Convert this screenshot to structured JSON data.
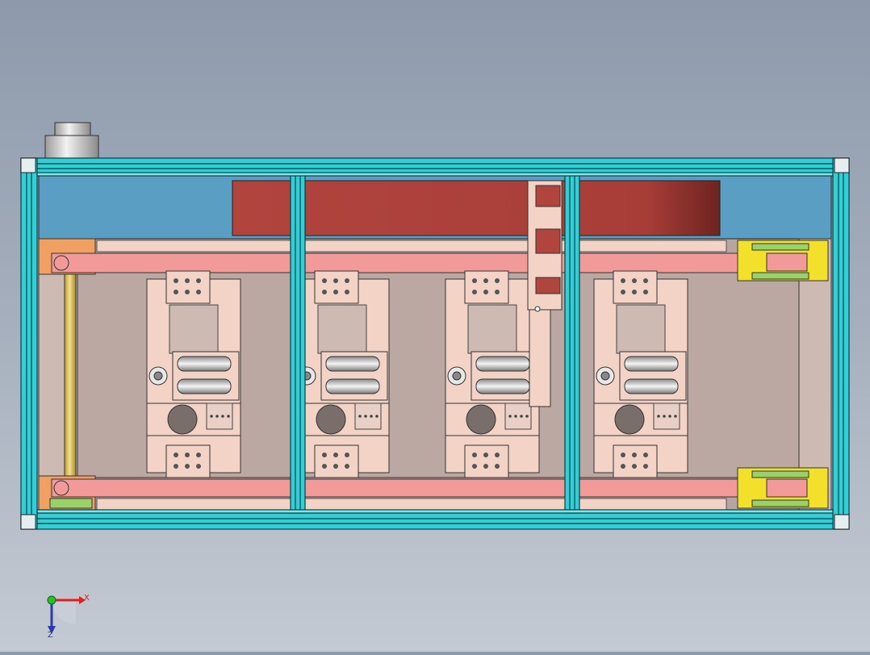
{
  "triad": {
    "x_label": "X",
    "z_label": "Z"
  },
  "colors": {
    "frame": "#33cfd7",
    "frame_dark": "#0b5c64",
    "rail": "#f29a9a",
    "plate": "#f3d3c6",
    "panel_red": "#b2443e",
    "panel_blue": "#5a9ec4",
    "bracket": "#f2e02a",
    "rod": "#e0c55c",
    "motor": "#d9d9d9",
    "inner_bg": "#b8a59f"
  }
}
